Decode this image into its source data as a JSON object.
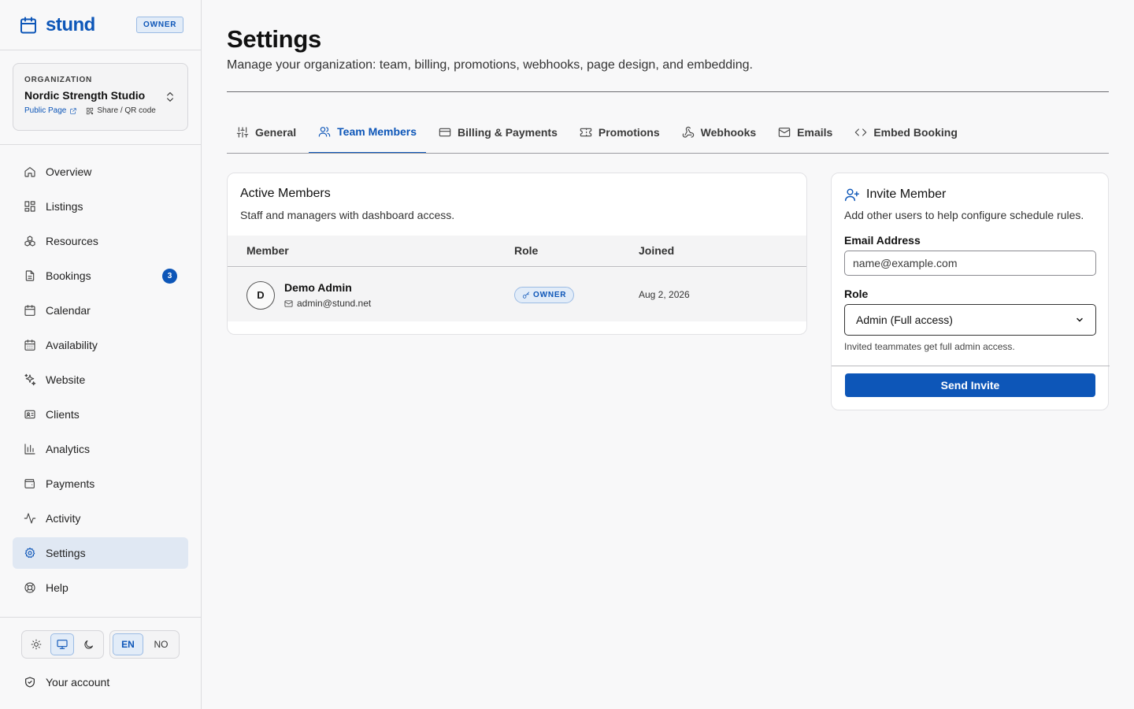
{
  "brand": {
    "name": "stund",
    "role_badge": "OWNER"
  },
  "organization": {
    "label": "ORGANIZATION",
    "name": "Nordic Strength Studio",
    "public_page": "Public Page",
    "share": "Share / QR code"
  },
  "nav": [
    {
      "label": "Overview",
      "icon": "home-icon"
    },
    {
      "label": "Listings",
      "icon": "grid-icon"
    },
    {
      "label": "Resources",
      "icon": "boxes-icon"
    },
    {
      "label": "Bookings",
      "icon": "file-icon",
      "count": "3"
    },
    {
      "label": "Calendar",
      "icon": "calendar-icon"
    },
    {
      "label": "Availability",
      "icon": "calendar-days-icon"
    },
    {
      "label": "Website",
      "icon": "sparkles-icon"
    },
    {
      "label": "Clients",
      "icon": "id-card-icon"
    },
    {
      "label": "Analytics",
      "icon": "bar-chart-icon"
    },
    {
      "label": "Payments",
      "icon": "wallet-icon"
    },
    {
      "label": "Activity",
      "icon": "activity-icon"
    },
    {
      "label": "Settings",
      "icon": "gear-icon",
      "active": true
    },
    {
      "label": "Help",
      "icon": "life-buoy-icon"
    }
  ],
  "footer": {
    "theme_active": "system",
    "lang_en": "EN",
    "lang_no": "NO",
    "account": "Your account"
  },
  "page": {
    "title": "Settings",
    "subtitle": "Manage your organization: team, billing, promotions, webhooks, page design, and embedding."
  },
  "tabs": [
    {
      "label": "General",
      "icon": "sliders-icon"
    },
    {
      "label": "Team Members",
      "icon": "users-icon",
      "active": true
    },
    {
      "label": "Billing & Payments",
      "icon": "credit-card-icon"
    },
    {
      "label": "Promotions",
      "icon": "ticket-icon"
    },
    {
      "label": "Webhooks",
      "icon": "webhook-icon"
    },
    {
      "label": "Emails",
      "icon": "mail-icon"
    },
    {
      "label": "Embed Booking",
      "icon": "code-icon"
    }
  ],
  "members": {
    "title": "Active Members",
    "subtitle": "Staff and managers with dashboard access.",
    "columns": {
      "member": "Member",
      "role": "Role",
      "joined": "Joined"
    },
    "rows": [
      {
        "initial": "D",
        "name": "Demo Admin",
        "email": "admin@stund.net",
        "role": "OWNER",
        "joined": "Aug 2, 2026"
      }
    ]
  },
  "invite": {
    "title": "Invite Member",
    "subtitle": "Add other users to help configure schedule rules.",
    "email_label": "Email Address",
    "email_placeholder": "name@example.com",
    "email_value": "",
    "role_label": "Role",
    "role_value": "Admin (Full access)",
    "hint": "Invited teammates get full admin access.",
    "send_label": "Send Invite"
  },
  "colors": {
    "accent": "#0d56b8",
    "accent_soft": "#e2ecf8"
  }
}
